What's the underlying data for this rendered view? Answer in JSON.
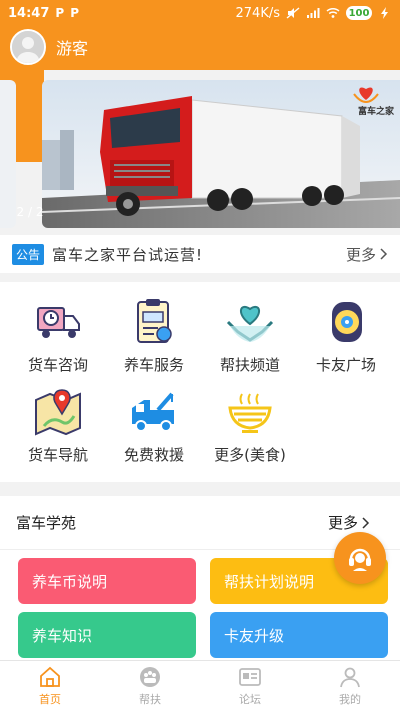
{
  "status_bar": {
    "time": "14:47",
    "left_icons": [
      "P",
      "P"
    ],
    "net_speed": "274K/s",
    "battery": "100"
  },
  "header": {
    "username": "游客"
  },
  "banner": {
    "counter": "2 / 2",
    "brand": "富车之家"
  },
  "notice": {
    "badge": "公告",
    "text": "富车之家平台试运营!",
    "more": "更多"
  },
  "grid": [
    {
      "label": "货车咨询",
      "icon": "truck-clock-icon"
    },
    {
      "label": "养车服务",
      "icon": "clipboard-truck-icon"
    },
    {
      "label": "帮扶频道",
      "icon": "heart-hands-icon"
    },
    {
      "label": "卡友广场",
      "icon": "tire-icon"
    },
    {
      "label": "货车导航",
      "icon": "map-pin-icon"
    },
    {
      "label": "免费救援",
      "icon": "tow-truck-icon"
    },
    {
      "label": "更多(美食)",
      "icon": "noodle-bowl-icon"
    }
  ],
  "academy": {
    "title": "富车学苑",
    "more": "更多",
    "tiles": [
      {
        "label": "养车币说明",
        "color": "#fa5b73"
      },
      {
        "label": "帮扶计划说明",
        "color": "#fdbd12"
      },
      {
        "label": "养车知识",
        "color": "#36c98c"
      },
      {
        "label": "卡友升级",
        "color": "#3aa0f2"
      }
    ]
  },
  "tabbar": [
    {
      "label": "首页",
      "active": true
    },
    {
      "label": "帮扶",
      "active": false
    },
    {
      "label": "论坛",
      "active": false
    },
    {
      "label": "我的",
      "active": false
    }
  ],
  "colors": {
    "brand": "#f7931e",
    "notice_badge": "#1e8de3"
  }
}
